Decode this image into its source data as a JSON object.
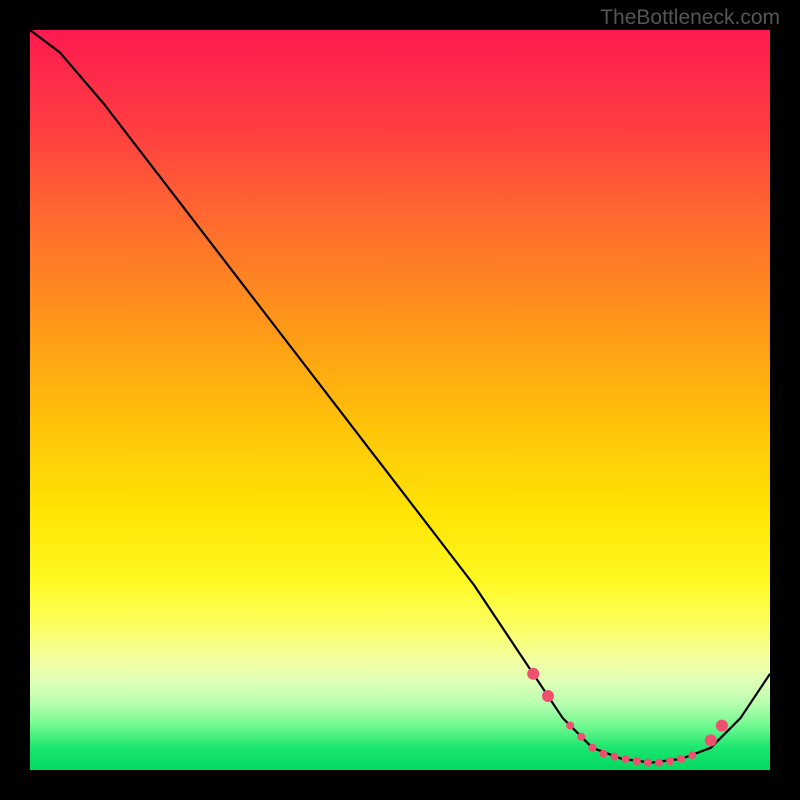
{
  "watermark": "TheBottleneck.com",
  "chart_data": {
    "type": "line",
    "title": "",
    "xlabel": "",
    "ylabel": "",
    "xlim": [
      0,
      100
    ],
    "ylim": [
      0,
      100
    ],
    "background_gradient": {
      "top": "#ff1a50",
      "mid_top": "#ff8820",
      "mid": "#fff820",
      "mid_bottom": "#e0ffb8",
      "bottom": "#00d860"
    },
    "series": [
      {
        "name": "main-curve",
        "color": "#000000",
        "x": [
          0,
          4,
          10,
          20,
          30,
          40,
          50,
          60,
          68,
          72,
          76,
          80,
          84,
          88,
          92,
          96,
          100
        ],
        "y": [
          100,
          97,
          90,
          77,
          64,
          51,
          38,
          25,
          13,
          7,
          3,
          1.5,
          1,
          1.5,
          3,
          7,
          13
        ]
      }
    ],
    "markers": {
      "name": "basin-markers",
      "color": "#f05070",
      "size_small": 4,
      "size_large": 6,
      "points": [
        {
          "x": 68,
          "y": 13,
          "size": "large"
        },
        {
          "x": 70,
          "y": 10,
          "size": "large"
        },
        {
          "x": 73,
          "y": 6,
          "size": "small"
        },
        {
          "x": 74.5,
          "y": 4.5,
          "size": "small"
        },
        {
          "x": 76,
          "y": 3,
          "size": "small"
        },
        {
          "x": 77.5,
          "y": 2.2,
          "size": "small"
        },
        {
          "x": 79,
          "y": 1.8,
          "size": "small"
        },
        {
          "x": 80.5,
          "y": 1.5,
          "size": "small"
        },
        {
          "x": 82,
          "y": 1.2,
          "size": "small"
        },
        {
          "x": 83.5,
          "y": 1,
          "size": "small"
        },
        {
          "x": 85,
          "y": 1,
          "size": "small"
        },
        {
          "x": 86.5,
          "y": 1.2,
          "size": "small"
        },
        {
          "x": 88,
          "y": 1.5,
          "size": "small"
        },
        {
          "x": 89.5,
          "y": 2,
          "size": "small"
        },
        {
          "x": 92,
          "y": 4,
          "size": "large"
        },
        {
          "x": 93.5,
          "y": 6,
          "size": "large"
        }
      ]
    }
  }
}
